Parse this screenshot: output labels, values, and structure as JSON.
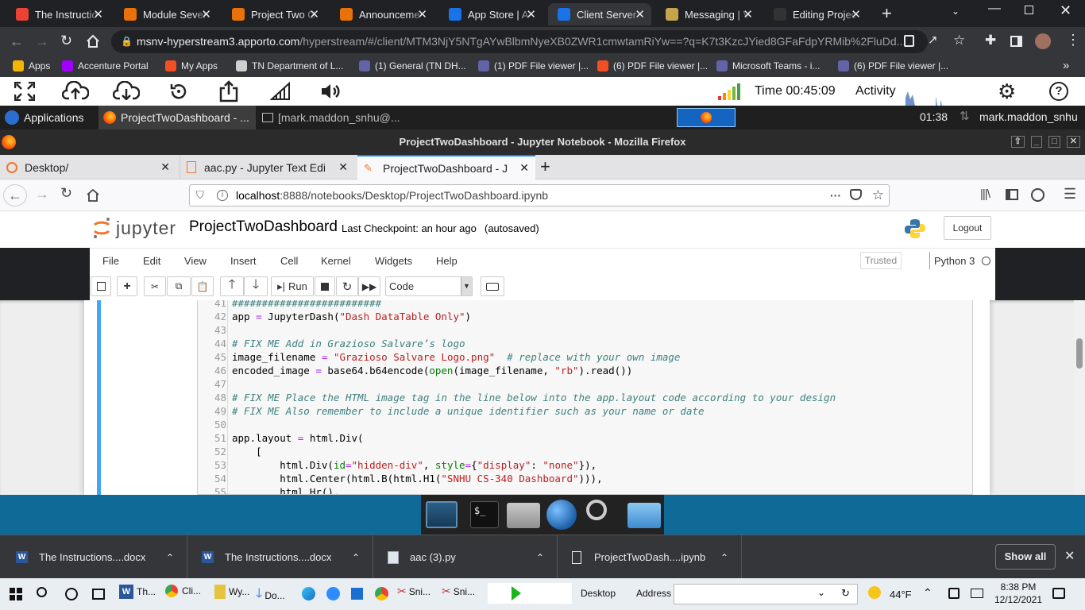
{
  "chrome": {
    "tabs": [
      {
        "title": "The Instructio",
        "icon": "gmail-icon",
        "color": "#ea4335"
      },
      {
        "title": "Module Seven",
        "icon": "brightspace-icon",
        "color": "#e8710a"
      },
      {
        "title": "Project Two G",
        "icon": "brightspace-icon",
        "color": "#e8710a"
      },
      {
        "title": "Announceme",
        "icon": "brightspace-icon",
        "color": "#e8710a"
      },
      {
        "title": "App Store | A",
        "icon": "apporto-icon",
        "color": "#1a73e8"
      },
      {
        "title": "Client Server",
        "icon": "apporto-icon",
        "color": "#1a73e8"
      },
      {
        "title": "Messaging | V",
        "icon": "house-icon",
        "color": "#c5a54b"
      },
      {
        "title": "Editing Projec",
        "icon": "github-icon",
        "color": "#333333"
      }
    ],
    "url_host": "msnv-hyperstream3.apporto.com",
    "url_rest": "/hyperstream/#/client/MTM3NjY5NTgAYwBlbmNyeXB0ZWR1cmwtamRiYw==?q=K7t3KzcJYied8GFaFdpYRMib%2FluDd...",
    "bookmarks": [
      {
        "label": "Apps",
        "icon": "apps-grid-icon",
        "color": "#f4b400"
      },
      {
        "label": "Accenture Portal",
        "icon": "accenture-icon",
        "color": "#a100ff"
      },
      {
        "label": "My Apps",
        "icon": "microsoft-icon",
        "color": "#f25022"
      },
      {
        "label": "TN Department of L...",
        "icon": "tn-seal-icon",
        "color": "#cfcfcf"
      },
      {
        "label": "(1) General (TN DH...",
        "icon": "teams-icon",
        "color": "#6264a7"
      },
      {
        "label": "(1) PDF File viewer |...",
        "icon": "teams-icon",
        "color": "#6264a7"
      },
      {
        "label": "(6) PDF File viewer |...",
        "icon": "microsoft-icon",
        "color": "#f25022"
      },
      {
        "label": "Microsoft Teams - i...",
        "icon": "teams-icon",
        "color": "#6264a7"
      },
      {
        "label": "(6) PDF File viewer |...",
        "icon": "teams-icon",
        "color": "#6264a7"
      }
    ]
  },
  "apporto": {
    "time_label": "Time 00:45:09",
    "activity_label": "Activity"
  },
  "xfce": {
    "applications_label": "Applications",
    "window1": "ProjectTwoDashboard - ...",
    "window2": "[mark.maddon_snhu@...",
    "clock": "01:38",
    "user": "mark.maddon_snhu"
  },
  "firefox": {
    "window_title": "ProjectTwoDashboard - Jupyter Notebook - Mozilla Firefox",
    "tabs": [
      {
        "title": "Desktop/"
      },
      {
        "title": "aac.py - Jupyter Text Edi"
      },
      {
        "title": "ProjectTwoDashboard - J"
      }
    ],
    "url_host": "localhost",
    "url_rest": ":8888/notebooks/Desktop/ProjectTwoDashboard.ipynb"
  },
  "jupyter": {
    "logo_text": "jupyter",
    "notebook_name": "ProjectTwoDashboard",
    "checkpoint": "Last Checkpoint: an hour ago",
    "autosaved": "(autosaved)",
    "logout": "Logout",
    "menu": [
      "File",
      "Edit",
      "View",
      "Insert",
      "Cell",
      "Kernel",
      "Widgets",
      "Help"
    ],
    "trusted": "Trusted",
    "kernel": "Python 3",
    "run_label": "Run",
    "cell_type": "Code"
  },
  "code_lines": [
    {
      "n": "41",
      "tokens": [
        {
          "c": "cm",
          "t": "#########################"
        }
      ]
    },
    {
      "n": "42",
      "tokens": [
        {
          "c": "",
          "t": "app "
        },
        {
          "c": "op",
          "t": "="
        },
        {
          "c": "",
          "t": " JupyterDash("
        },
        {
          "c": "st",
          "t": "\"Dash DataTable Only\""
        },
        {
          "c": "",
          "t": ")"
        }
      ]
    },
    {
      "n": "43",
      "tokens": []
    },
    {
      "n": "44",
      "tokens": [
        {
          "c": "cm",
          "t": "# FIX ME Add in Grazioso Salvare’s logo"
        }
      ]
    },
    {
      "n": "45",
      "tokens": [
        {
          "c": "",
          "t": "image_filename "
        },
        {
          "c": "op",
          "t": "="
        },
        {
          "c": "",
          "t": " "
        },
        {
          "c": "st",
          "t": "\"Grazioso Salvare Logo.png\""
        },
        {
          "c": "",
          "t": "  "
        },
        {
          "c": "cm",
          "t": "# replace with your own image"
        }
      ]
    },
    {
      "n": "46",
      "tokens": [
        {
          "c": "",
          "t": "encoded_image "
        },
        {
          "c": "op",
          "t": "="
        },
        {
          "c": "",
          "t": " base64.b64encode("
        },
        {
          "c": "kw",
          "t": "open"
        },
        {
          "c": "",
          "t": "(image_filename, "
        },
        {
          "c": "st",
          "t": "\"rb\""
        },
        {
          "c": "",
          "t": ").read())"
        }
      ]
    },
    {
      "n": "47",
      "tokens": []
    },
    {
      "n": "48",
      "tokens": [
        {
          "c": "cm",
          "t": "# FIX ME Place the HTML image tag in the line below into the app.layout code according to your design"
        }
      ]
    },
    {
      "n": "49",
      "tokens": [
        {
          "c": "cm",
          "t": "# FIX ME Also remember to include a unique identifier such as your name or date"
        }
      ]
    },
    {
      "n": "50",
      "tokens": []
    },
    {
      "n": "51",
      "tokens": [
        {
          "c": "",
          "t": "app.layout "
        },
        {
          "c": "op",
          "t": "="
        },
        {
          "c": "",
          "t": " html.Div("
        }
      ]
    },
    {
      "n": "52",
      "tokens": [
        {
          "c": "",
          "t": "    ["
        }
      ]
    },
    {
      "n": "53",
      "tokens": [
        {
          "c": "",
          "t": "        html.Div("
        },
        {
          "c": "kw",
          "t": "id"
        },
        {
          "c": "op",
          "t": "="
        },
        {
          "c": "st",
          "t": "\"hidden-div\""
        },
        {
          "c": "",
          "t": ", "
        },
        {
          "c": "kw",
          "t": "style"
        },
        {
          "c": "op",
          "t": "="
        },
        {
          "c": "",
          "t": "{"
        },
        {
          "c": "st",
          "t": "\"display\""
        },
        {
          "c": "",
          "t": ": "
        },
        {
          "c": "st",
          "t": "\"none\""
        },
        {
          "c": "",
          "t": "}),"
        }
      ]
    },
    {
      "n": "54",
      "tokens": [
        {
          "c": "",
          "t": "        html.Center(html.B(html.H1("
        },
        {
          "c": "st",
          "t": "\"SNHU CS-340 Dashboard\""
        },
        {
          "c": "",
          "t": "))),"
        }
      ]
    },
    {
      "n": "55",
      "tokens": [
        {
          "c": "",
          "t": "        html.Hr(),"
        }
      ]
    }
  ],
  "downloads": {
    "items": [
      "The Instructions....docx",
      "The Instructions....docx",
      "aac (3).py",
      "ProjectTwoDash....ipynb"
    ],
    "show_all": "Show all"
  },
  "taskbar": {
    "apps": [
      "Th...",
      "Cli...",
      "Wy...",
      "Do...",
      "Sni...",
      "Sni..."
    ],
    "desktop_label": "Desktop",
    "address_label": "Address",
    "weather": "44°F",
    "time": "8:38 PM",
    "date": "12/12/2021"
  }
}
